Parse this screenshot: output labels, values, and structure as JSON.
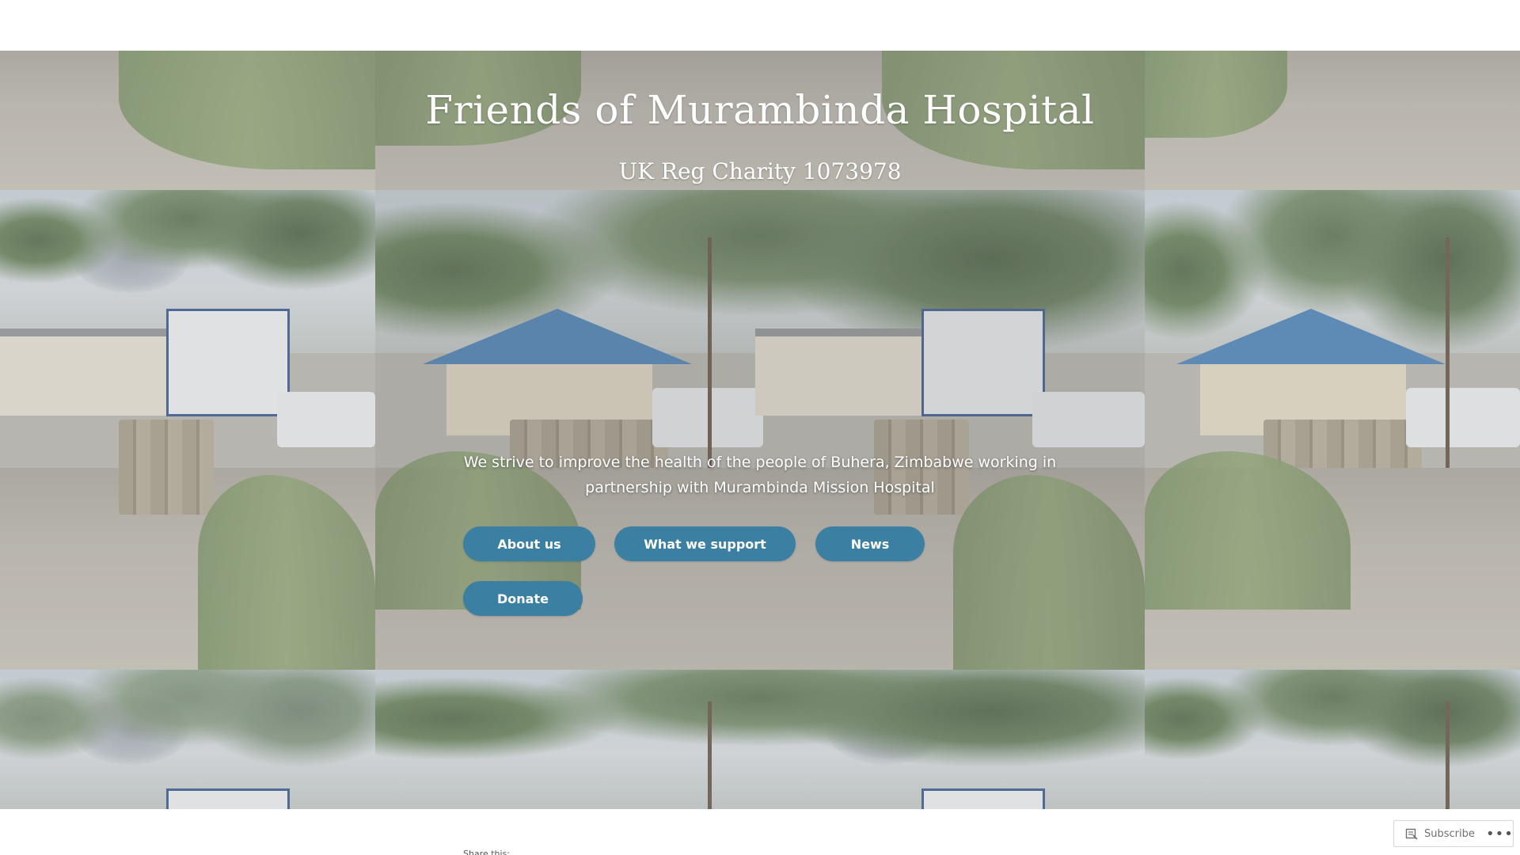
{
  "site": {
    "title": "Friends of Murambinda Hospital",
    "tagline": "UK Reg Charity 1073978",
    "mission": "We strive to improve the health of the people of Buhera, Zimbabwe working in partnership with Murambinda Mission Hospital"
  },
  "buttons": {
    "about": "About us",
    "support": "What we support",
    "news": "News",
    "donate": "Donate"
  },
  "footer": {
    "share_label": "Share this:"
  },
  "subscribe_bar": {
    "label": "Subscribe",
    "icon": "reader-icon",
    "more_icon": "ellipsis-icon"
  },
  "colors": {
    "button": "#3b7fa2",
    "title_text": "#ffffff"
  }
}
